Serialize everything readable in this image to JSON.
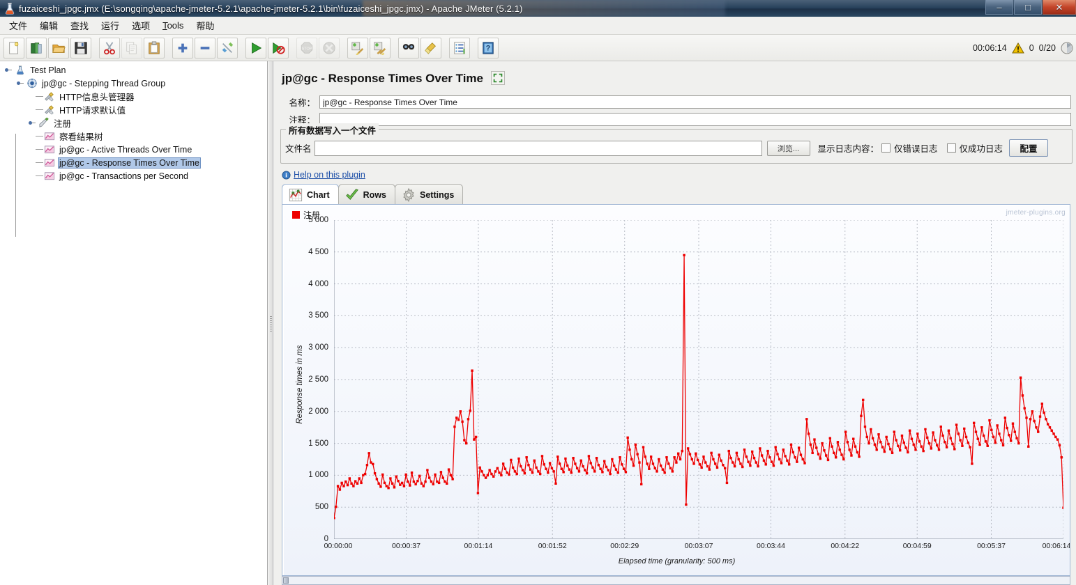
{
  "window": {
    "title": "fuzaiceshi_jpgc.jmx (E:\\songqing\\apache-jmeter-5.2.1\\apache-jmeter-5.2.1\\bin\\fuzaiceshi_jpgc.jmx) - Apache JMeter (5.2.1)",
    "app_icon": "jmeter-icon",
    "minimize": "–",
    "maximize": "□",
    "close": "✕"
  },
  "menu": [
    {
      "label": "文件",
      "mnemonic": ""
    },
    {
      "label": "编辑",
      "mnemonic": ""
    },
    {
      "label": "查找",
      "mnemonic": ""
    },
    {
      "label": "运行",
      "mnemonic": ""
    },
    {
      "label": "选项",
      "mnemonic": ""
    },
    {
      "label": "Tools",
      "mnemonic": "T"
    },
    {
      "label": "帮助",
      "mnemonic": ""
    }
  ],
  "toolbar": {
    "buttons": [
      {
        "name": "new-icon",
        "disabled": false
      },
      {
        "name": "templates-icon",
        "disabled": false
      },
      {
        "name": "open-icon",
        "disabled": false
      },
      {
        "name": "save-icon",
        "disabled": false
      },
      {
        "name": "cut-icon",
        "disabled": false
      },
      {
        "name": "copy-icon",
        "disabled": true
      },
      {
        "name": "paste-icon",
        "disabled": false
      },
      {
        "name": "expand-all-icon",
        "disabled": false
      },
      {
        "name": "collapse-all-icon",
        "disabled": false
      },
      {
        "name": "toggle-icon",
        "disabled": false
      },
      {
        "name": "start-icon",
        "disabled": false
      },
      {
        "name": "start-no-pauses-icon",
        "disabled": false
      },
      {
        "name": "stop-icon",
        "disabled": true
      },
      {
        "name": "shutdown-icon",
        "disabled": true
      },
      {
        "name": "clear-icon",
        "disabled": false
      },
      {
        "name": "clear-all-icon",
        "disabled": false
      },
      {
        "name": "search-icon",
        "disabled": false
      },
      {
        "name": "reset-search-icon",
        "disabled": false
      },
      {
        "name": "function-helper-icon",
        "disabled": false
      },
      {
        "name": "help-icon",
        "disabled": false
      }
    ],
    "elapsed_time": "00:06:14",
    "warning_count": "0",
    "thread_counter": "0/20",
    "warn_icon": "warning-triangle-icon",
    "gc_icon": "memory-gauge-icon"
  },
  "tree": {
    "items": [
      {
        "label": "Test Plan",
        "icon": "test-plan-icon",
        "depth": 0,
        "knob": true,
        "selected": false
      },
      {
        "label": "jp@gc - Stepping Thread Group",
        "icon": "thread-group-icon",
        "depth": 1,
        "knob": true,
        "selected": false
      },
      {
        "label": "HTTP信息头管理器",
        "icon": "config-element-icon",
        "depth": 2,
        "knob": false,
        "selected": false
      },
      {
        "label": "HTTP请求默认值",
        "icon": "config-element-icon",
        "depth": 2,
        "knob": false,
        "selected": false
      },
      {
        "label": "注册",
        "icon": "http-sampler-icon",
        "depth": 2,
        "knob": true,
        "selected": false
      },
      {
        "label": "察看结果树",
        "icon": "listener-icon",
        "depth": 2,
        "knob": false,
        "selected": false
      },
      {
        "label": "jp@gc - Active Threads Over Time",
        "icon": "listener-icon",
        "depth": 2,
        "knob": false,
        "selected": false
      },
      {
        "label": "jp@gc - Response Times Over Time",
        "icon": "listener-icon",
        "depth": 2,
        "knob": false,
        "selected": true
      },
      {
        "label": "jp@gc - Transactions per Second",
        "icon": "listener-icon",
        "depth": 2,
        "knob": false,
        "selected": false
      }
    ]
  },
  "panel": {
    "title": "jp@gc - Response Times Over Time",
    "expand_icon": "expand-collapse-icon",
    "name_label": "名称：",
    "name_value": "jp@gc - Response Times Over Time",
    "comment_label": "注释：",
    "comment_value": "",
    "group_legend": "所有数据写入一个文件",
    "filename_label": "文件名",
    "filename_value": "",
    "browse_button": "浏览...",
    "log_display_label": "显示日志内容：",
    "errors_only_label": "仅错误日志",
    "errors_only_checked": false,
    "success_only_label": "仅成功日志",
    "success_only_checked": false,
    "configure_button": "配置",
    "help_link": "Help on this plugin",
    "help_icon": "info-icon"
  },
  "tabs": [
    {
      "label": "Chart",
      "icon": "chart-icon",
      "active": true
    },
    {
      "label": "Rows",
      "icon": "check-icon",
      "active": false
    },
    {
      "label": "Settings",
      "icon": "gear-icon",
      "active": false
    }
  ],
  "chart_data": {
    "type": "line",
    "title": "",
    "watermark": "jmeter-plugins.org",
    "xlabel": "Elapsed time (granularity: 500 ms)",
    "ylabel": "Response times in ms",
    "ylim": [
      0,
      5000
    ],
    "yticks": [
      0,
      500,
      1000,
      1500,
      2000,
      2500,
      3000,
      3500,
      4000,
      4500,
      5000
    ],
    "ytick_labels": [
      "0",
      "500",
      "1 000",
      "1 500",
      "2 000",
      "2 500",
      "3 000",
      "3 500",
      "4 000",
      "4 500",
      "5 000"
    ],
    "xlim": [
      0,
      374
    ],
    "xticks": [
      0,
      37,
      74,
      112,
      149,
      187,
      224,
      262,
      299,
      337,
      374
    ],
    "xtick_labels": [
      "00:00:00",
      "00:00:37",
      "00:01:14",
      "00:01:52",
      "00:02:29",
      "00:03:07",
      "00:03:44",
      "00:04:22",
      "00:04:59",
      "00:05:37",
      "00:06:14"
    ],
    "grid": true,
    "legend_position": "top-left",
    "series": [
      {
        "name": "注册",
        "color": "#ee0000",
        "marker": "square",
        "values": [
          330,
          505,
          830,
          775,
          880,
          830,
          900,
          845,
          950,
          870,
          830,
          905,
          870,
          950,
          880,
          1000,
          1020,
          1160,
          1345,
          1200,
          1175,
          1030,
          940,
          870,
          820,
          1010,
          880,
          830,
          800,
          950,
          870,
          810,
          980,
          910,
          850,
          880,
          830,
          1010,
          900,
          840,
          1040,
          900,
          860,
          910,
          990,
          870,
          830,
          900,
          1080,
          960,
          900,
          860,
          1010,
          900,
          880,
          1050,
          960,
          900,
          870,
          1090,
          1000,
          940,
          1760,
          1900,
          1870,
          2000,
          1840,
          1550,
          1500,
          1880,
          2010,
          2640,
          1560,
          1600,
          720,
          1120,
          1060,
          1000,
          960,
          1000,
          1080,
          1020,
          980,
          1060,
          1110,
          1040,
          1000,
          1180,
          1100,
          1040,
          1010,
          1240,
          1120,
          1060,
          1020,
          1260,
          1140,
          1080,
          1030,
          1280,
          1160,
          1090,
          1040,
          1230,
          1120,
          1060,
          1020,
          1300,
          1170,
          1100,
          1040,
          1190,
          1110,
          1060,
          870,
          1290,
          1180,
          1100,
          1050,
          1260,
          1150,
          1090,
          1040,
          1270,
          1180,
          1110,
          1060,
          1230,
          1140,
          1080,
          1030,
          1300,
          1190,
          1120,
          1060,
          1270,
          1160,
          1100,
          1050,
          1220,
          1130,
          1080,
          1020,
          1250,
          1150,
          1090,
          1040,
          1280,
          1170,
          1100,
          1050,
          1590,
          1400,
          1250,
          1150,
          1480,
          1330,
          1200,
          860,
          1440,
          1290,
          1180,
          1100,
          1290,
          1180,
          1110,
          1060,
          1250,
          1150,
          1090,
          1040,
          1280,
          1180,
          1110,
          1060,
          1280,
          1200,
          1340,
          1250,
          1380,
          4450,
          540,
          1420,
          1330,
          1250,
          1180,
          1340,
          1240,
          1170,
          1120,
          1290,
          1200,
          1140,
          1090,
          1350,
          1250,
          1180,
          1120,
          1320,
          1230,
          1160,
          1110,
          880,
          1380,
          1270,
          1200,
          1140,
          1350,
          1250,
          1180,
          1130,
          1400,
          1290,
          1210,
          1150,
          1370,
          1270,
          1200,
          1140,
          1420,
          1310,
          1230,
          1170,
          1380,
          1280,
          1210,
          1150,
          1440,
          1330,
          1250,
          1190,
          1400,
          1300,
          1230,
          1170,
          1480,
          1360,
          1280,
          1210,
          1430,
          1320,
          1250,
          1190,
          1880,
          1650,
          1480,
          1350,
          1560,
          1430,
          1330,
          1260,
          1500,
          1390,
          1310,
          1240,
          1580,
          1450,
          1350,
          1280,
          1520,
          1400,
          1320,
          1250,
          1680,
          1520,
          1400,
          1310,
          1570,
          1450,
          1360,
          1290,
          1930,
          2180,
          1760,
          1600,
          1500,
          1720,
          1580,
          1480,
          1400,
          1640,
          1520,
          1440,
          1370,
          1600,
          1490,
          1410,
          1350,
          1680,
          1550,
          1460,
          1390,
          1620,
          1510,
          1430,
          1360,
          1700,
          1570,
          1480,
          1400,
          1650,
          1530,
          1450,
          1380,
          1720,
          1590,
          1500,
          1420,
          1670,
          1550,
          1470,
          1400,
          1760,
          1620,
          1520,
          1440,
          1700,
          1580,
          1490,
          1410,
          1790,
          1650,
          1550,
          1460,
          1730,
          1600,
          1510,
          1440,
          1180,
          1820,
          1680,
          1570,
          1480,
          1750,
          1620,
          1530,
          1460,
          1860,
          1710,
          1600,
          1510,
          1780,
          1650,
          1550,
          1470,
          1900,
          1740,
          1630,
          1540,
          1810,
          1680,
          1580,
          1500,
          2530,
          2250,
          2050,
          1900,
          1450,
          1880,
          2000,
          1850,
          1750,
          1680,
          1920,
          2120,
          1980,
          1880,
          1800,
          1750,
          1700,
          1650,
          1600,
          1560,
          1470,
          1280,
          490
        ]
      }
    ]
  },
  "colors": {
    "accent_red": "#ee0000",
    "selection_blue": "#b0c8e8",
    "link_blue": "#1d4fa8",
    "chart_bg_top": "#fcfdff",
    "chart_bg_bottom": "#eef2fa"
  }
}
